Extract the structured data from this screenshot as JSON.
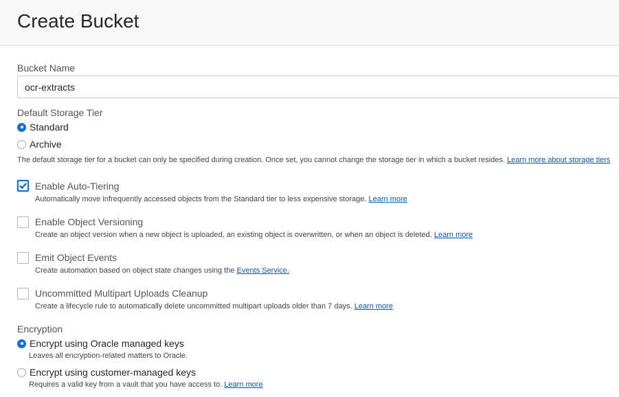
{
  "header": {
    "title": "Create Bucket"
  },
  "bucket_name": {
    "label": "Bucket Name",
    "value": "ocr-extracts"
  },
  "storage_tier": {
    "label": "Default Storage Tier",
    "options": [
      {
        "label": "Standard",
        "selected": true
      },
      {
        "label": "Archive",
        "selected": false
      }
    ],
    "help": "The default storage tier for a bucket can only be specified during creation. Once set, you cannot change the storage tier in which a bucket resides.",
    "help_link": "Learn more about storage tiers"
  },
  "options": [
    {
      "label": "Enable Auto-Tiering",
      "checked": true,
      "help": "Automatically move infrequently accessed objects from the Standard tier to less expensive storage.",
      "link": "Learn more"
    },
    {
      "label": "Enable Object Versioning",
      "checked": false,
      "help": "Create an object version when a new object is uploaded, an existing object is overwritten, or when an object is deleted.",
      "link": "Learn more"
    },
    {
      "label": "Emit Object Events",
      "checked": false,
      "help": "Create automation based on object state changes using the",
      "link": "Events Service."
    },
    {
      "label": "Uncommitted Multipart Uploads Cleanup",
      "checked": false,
      "help": "Create a lifecycle rule to automatically delete uncommitted multipart uploads older than 7 days.",
      "link": "Learn more"
    }
  ],
  "encryption": {
    "label": "Encryption",
    "options": [
      {
        "label": "Encrypt using Oracle managed keys",
        "selected": true,
        "help": "Leaves all encryption-related matters to Oracle."
      },
      {
        "label": "Encrypt using customer-managed keys",
        "selected": false,
        "help": "Requires a valid key from a vault that you have access to.",
        "link": "Learn more"
      }
    ]
  },
  "colors": {
    "accent": "#1a73c8",
    "link": "#0b58a8",
    "header_bg": "#f7f7f7"
  }
}
